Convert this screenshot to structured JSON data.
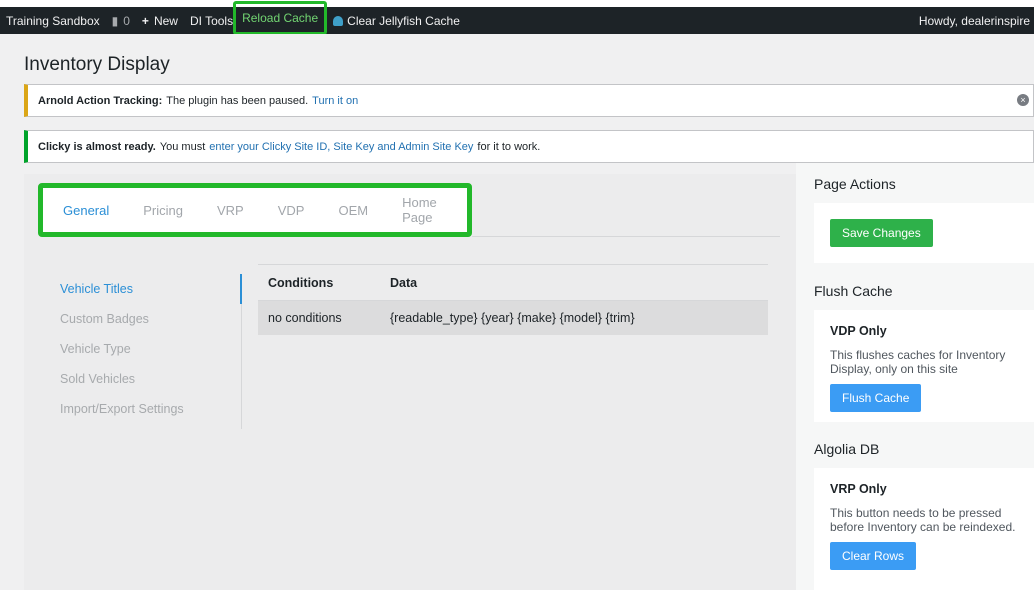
{
  "adminbar": {
    "site_name": "Training Sandbox",
    "comments_count": "0",
    "new_label": "New",
    "di_tools_label": "DI Tools",
    "reload_cache_label": "Reload Cache",
    "clear_jellyfish_label": "Clear Jellyfish Cache",
    "howdy": "Howdy, dealerinspire"
  },
  "page": {
    "title": "Inventory Display"
  },
  "notices": {
    "arnold": {
      "strong": "Arnold Action Tracking:",
      "text": "The plugin has been paused.",
      "link": "Turn it on"
    },
    "clicky": {
      "strong": "Clicky is almost ready.",
      "text_before": "You must",
      "link": "enter your Clicky Site ID, Site Key and Admin Site Key",
      "text_after": "for it to work."
    }
  },
  "tabs": [
    {
      "label": "General"
    },
    {
      "label": "Pricing"
    },
    {
      "label": "VRP"
    },
    {
      "label": "VDP"
    },
    {
      "label": "OEM"
    },
    {
      "label": "Home Page"
    }
  ],
  "side_nav": [
    {
      "label": "Vehicle Titles"
    },
    {
      "label": "Custom Badges"
    },
    {
      "label": "Vehicle Type"
    },
    {
      "label": "Sold Vehicles"
    },
    {
      "label": "Import/Export Settings"
    }
  ],
  "table": {
    "headers": [
      "Conditions",
      "Data"
    ],
    "rows": [
      {
        "conditions": "no conditions",
        "data": "{readable_type} {year} {make} {model} {trim}"
      }
    ]
  },
  "sidebar": {
    "page_actions_title": "Page Actions",
    "save_label": "Save Changes",
    "flush_title": "Flush Cache",
    "flush_heading": "VDP Only",
    "flush_desc": "This flushes caches for Inventory Display, only on this site",
    "flush_button": "Flush Cache",
    "algolia_title": "Algolia DB",
    "algolia_heading": "VRP Only",
    "algolia_desc": "This button needs to be pressed before Inventory can be reindexed.",
    "algolia_button": "Clear Rows"
  },
  "colors": {
    "highlight": "#22b82a",
    "link": "#2271b1",
    "active_tab": "#2b8fd6"
  }
}
